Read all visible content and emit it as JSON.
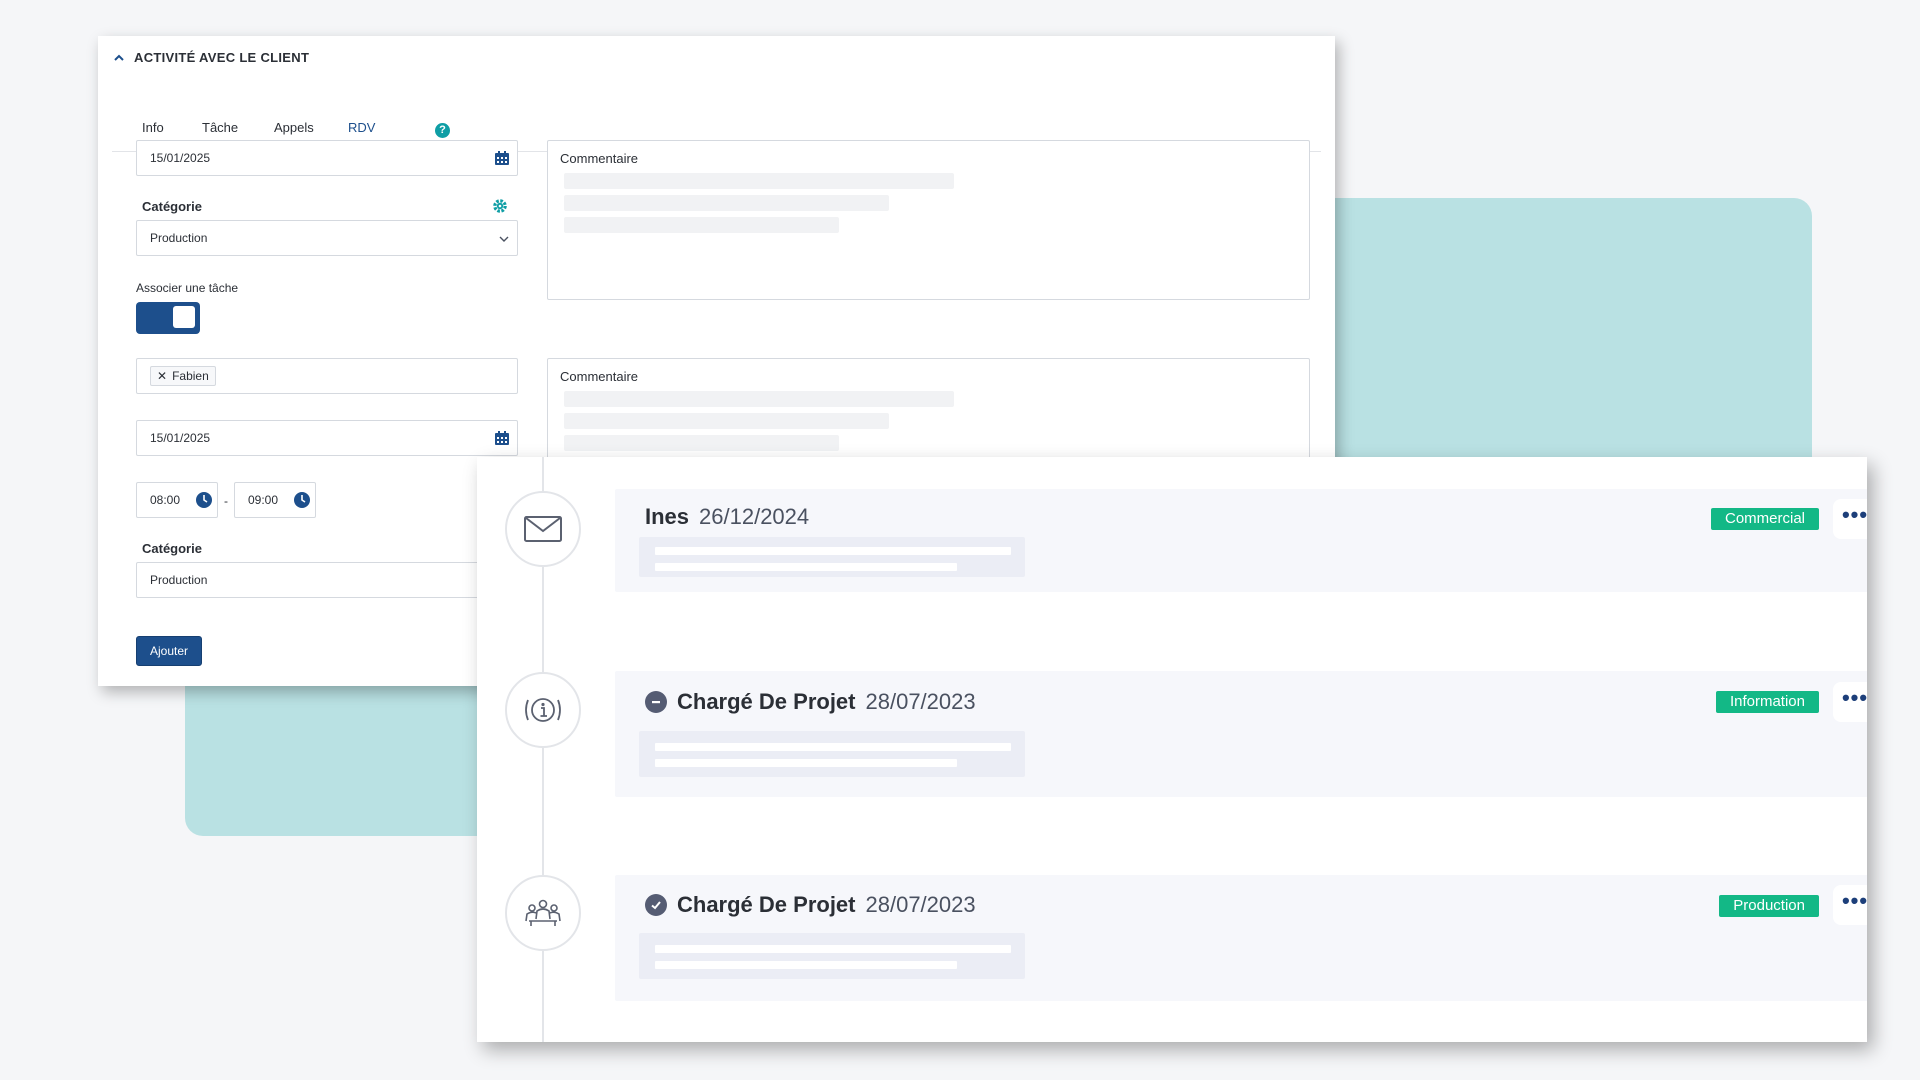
{
  "form": {
    "section_title": "ACTIVITÉ AVEC LE CLIENT",
    "tabs": [
      {
        "label": "Info"
      },
      {
        "label": "Tâche"
      },
      {
        "label": "Appels"
      },
      {
        "label": "RDV"
      }
    ],
    "active_tab": "RDV",
    "help_glyph": "?",
    "date_1": "15/01/2025",
    "category_label": "Catégorie",
    "category_value": "Production",
    "associate_task_label": "Associer une tâche",
    "associate_task_on": true,
    "assignee_chip": "Fabien",
    "date_2": "15/01/2025",
    "time_start": "08:00",
    "time_separator": "-",
    "time_end": "09:00",
    "category_label_2": "Catégorie",
    "category_value_2": "Production",
    "add_button": "Ajouter",
    "comment_label_1": "Commentaire",
    "comment_label_2": "Commentaire"
  },
  "timeline": {
    "items": [
      {
        "icon": "envelope-icon",
        "status": "",
        "name": "Ines",
        "date": "26/12/2024",
        "tag": "Commercial",
        "more": "•••"
      },
      {
        "icon": "info-meeting-icon",
        "status": "pending",
        "name": "Chargé De Projet",
        "date": "28/07/2023",
        "tag": "Information",
        "more": "•••"
      },
      {
        "icon": "group-icon",
        "status": "done",
        "name": "Chargé De Projet",
        "date": "28/07/2023",
        "tag": "Production",
        "more": "•••"
      }
    ]
  },
  "colors": {
    "accent": "#1d4f8c",
    "tag_green": "#13b886",
    "teal_background": "#b9e1e3",
    "help_teal": "#0f9ea5"
  }
}
